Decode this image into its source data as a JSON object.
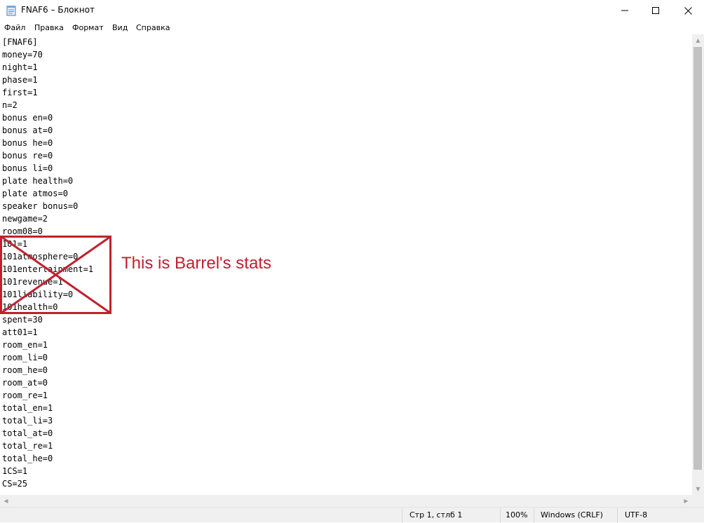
{
  "window": {
    "title": "FNAF6 – Блокнот",
    "icon": "notepad-icon"
  },
  "menu": {
    "items": [
      "Файл",
      "Правка",
      "Формат",
      "Вид",
      "Справка"
    ]
  },
  "document": {
    "lines": [
      "[FNAF6]",
      "money=70",
      "night=1",
      "phase=1",
      "first=1",
      "n=2",
      "bonus en=0",
      "bonus at=0",
      "bonus he=0",
      "bonus re=0",
      "bonus li=0",
      "plate health=0",
      "plate atmos=0",
      "speaker bonus=0",
      "newgame=2",
      "room08=0",
      "101=1",
      "101atmosphere=0",
      "101entertainment=1",
      "101revenue=1",
      "101liability=0",
      "101health=0",
      "spent=30",
      "att01=1",
      "room_en=1",
      "room_li=0",
      "room_he=0",
      "room_at=0",
      "room_re=1",
      "total_en=1",
      "total_li=3",
      "total_at=0",
      "total_re=1",
      "total_he=0",
      "1CS=1",
      "CS=25"
    ]
  },
  "annotation": {
    "text": "This is Barrel's stats",
    "color": "#c0202e"
  },
  "status": {
    "position": "Стр 1, стлб 1",
    "zoom": "100%",
    "line_ending": "Windows (CRLF)",
    "encoding": "UTF-8"
  }
}
